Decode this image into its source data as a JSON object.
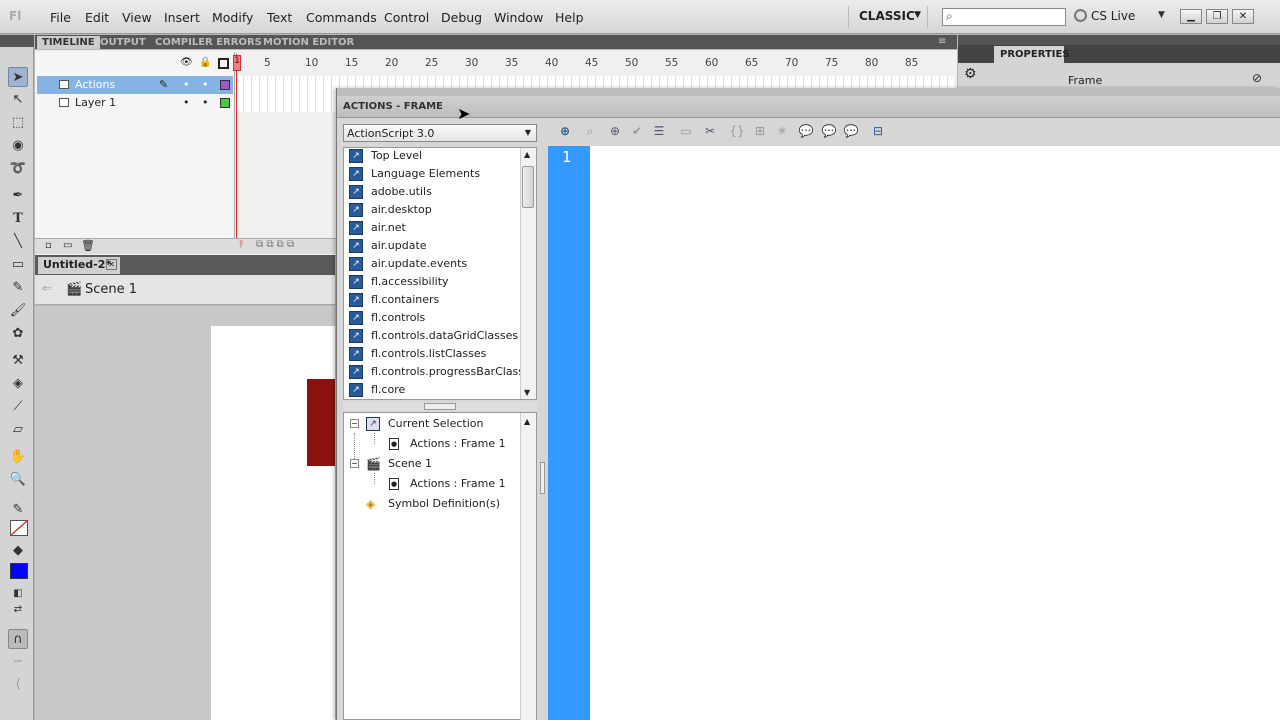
{
  "app": {
    "logo": "Fl",
    "workspace": "CLASSIC",
    "cslive": "CS Live"
  },
  "menu": [
    "File",
    "Edit",
    "View",
    "Insert",
    "Modify",
    "Text",
    "Commands",
    "Control",
    "Debug",
    "Window",
    "Help"
  ],
  "search": {
    "placeholder": ""
  },
  "timeline": {
    "tabs": [
      "TIMELINE",
      "OUTPUT",
      "COMPILER ERRORS",
      "MOTION EDITOR"
    ],
    "layers": [
      "Actions",
      "Layer 1"
    ],
    "frame_numbers": [
      "5",
      "10",
      "15",
      "20",
      "25",
      "30",
      "35",
      "40",
      "45",
      "50",
      "55",
      "60",
      "65",
      "70",
      "75",
      "80",
      "85"
    ],
    "current_frame": "1"
  },
  "document": {
    "tab": "Untitled-2*",
    "scene": "Scene 1"
  },
  "properties": {
    "tab": "PROPERTIES",
    "label": "Frame"
  },
  "actions": {
    "title": "ACTIONS - FRAME",
    "language": "ActionScript 3.0",
    "toolbox": [
      "Top Level",
      "Language Elements",
      "adobe.utils",
      "air.desktop",
      "air.net",
      "air.update",
      "air.update.events",
      "fl.accessibility",
      "fl.containers",
      "fl.controls",
      "fl.controls.dataGridClasses",
      "fl.controls.listClasses",
      "fl.controls.progressBarClasses",
      "fl.core"
    ],
    "script_tree": {
      "current_selection": "Current Selection",
      "cs_child": "Actions : Frame 1",
      "scene": "Scene 1",
      "scene_child": "Actions : Frame 1",
      "symbols": "Symbol Definition(s)"
    },
    "line_number": "1"
  },
  "colors": {
    "stroke_swatch": "#d04040",
    "fill_swatch": "#0000ff",
    "gutter": "#3399ff",
    "stage_rect": "#8b1010",
    "selected_layer": "#84b3e4"
  }
}
